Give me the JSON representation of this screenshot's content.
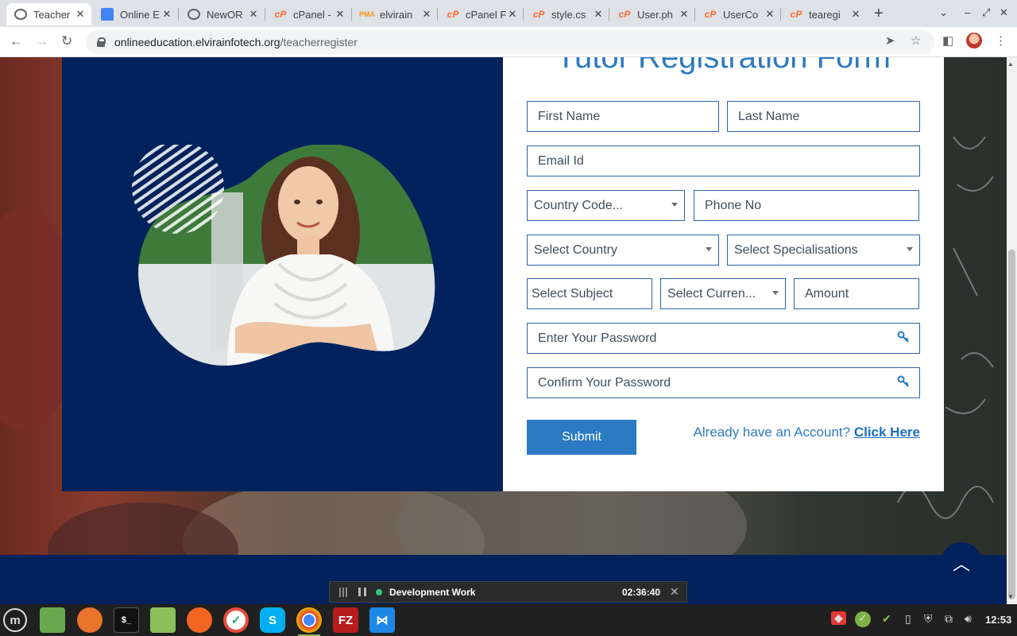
{
  "browser": {
    "tabs": [
      {
        "title": "Teacher",
        "icon": "globe-icon",
        "active": true
      },
      {
        "title": "Online E",
        "icon": "docs-icon"
      },
      {
        "title": "NewOR",
        "icon": "globe-icon"
      },
      {
        "title": "cPanel -",
        "icon": "cpanel-icon"
      },
      {
        "title": "elvirain",
        "icon": "phpmyadmin-icon"
      },
      {
        "title": "cPanel F",
        "icon": "cpanel-icon"
      },
      {
        "title": "style.cs",
        "icon": "cpanel-icon"
      },
      {
        "title": "User.ph",
        "icon": "cpanel-icon"
      },
      {
        "title": "UserCo",
        "icon": "cpanel-icon"
      },
      {
        "title": "tearegi",
        "icon": "cpanel-icon"
      }
    ],
    "close_glyph": "✕",
    "new_tab_glyph": "+",
    "url_host": "onlineeducation.elvirainfotech.org",
    "url_path": "/teacherregister"
  },
  "form": {
    "title": "Tutor Registration Form",
    "first_name_placeholder": "First Name",
    "last_name_placeholder": "Last Name",
    "email_placeholder": "Email Id",
    "country_code_label": "Country Code...",
    "phone_placeholder": "Phone No",
    "country_label": "Select Country",
    "specialisation_label": "Select Specialisations",
    "subject_label": "Select Subject",
    "currency_label": "Select Curren...",
    "amount_placeholder": "Amount",
    "password_placeholder": "Enter Your Password",
    "confirm_password_placeholder": "Confirm Your Password",
    "submit_label": "Submit",
    "account_prompt": "Already have an Account?",
    "account_link": "Click Here"
  },
  "timer": {
    "task": "Development Work",
    "elapsed": "02:36:40"
  },
  "taskbar": {
    "clock": "12:53"
  },
  "colors": {
    "navy": "#01225c",
    "accent_blue": "#2b7ac2",
    "field_border": "#2a63a8"
  }
}
